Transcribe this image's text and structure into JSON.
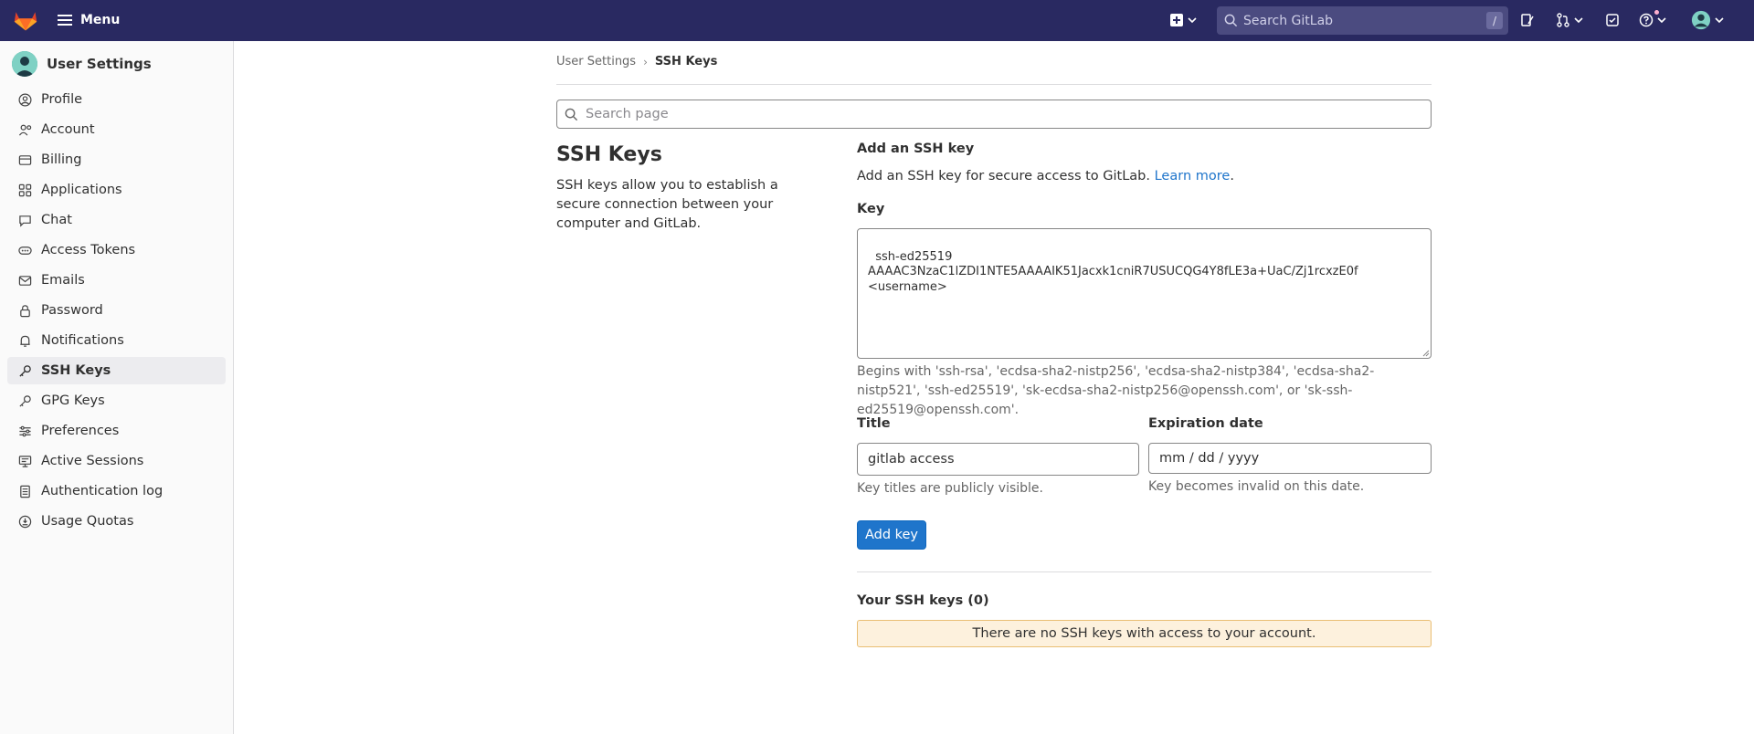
{
  "topbar": {
    "menu_label": "Menu",
    "search_placeholder": "Search GitLab",
    "search_shortcut": "/"
  },
  "sidebar": {
    "title": "User Settings",
    "items": [
      {
        "label": "Profile",
        "icon": "user-icon"
      },
      {
        "label": "Account",
        "icon": "account-icon"
      },
      {
        "label": "Billing",
        "icon": "billing-icon"
      },
      {
        "label": "Applications",
        "icon": "applications-icon"
      },
      {
        "label": "Chat",
        "icon": "chat-icon"
      },
      {
        "label": "Access Tokens",
        "icon": "token-icon"
      },
      {
        "label": "Emails",
        "icon": "mail-icon"
      },
      {
        "label": "Password",
        "icon": "lock-icon"
      },
      {
        "label": "Notifications",
        "icon": "bell-icon"
      },
      {
        "label": "SSH Keys",
        "icon": "key-icon",
        "active": true
      },
      {
        "label": "GPG Keys",
        "icon": "key-icon"
      },
      {
        "label": "Preferences",
        "icon": "preferences-icon"
      },
      {
        "label": "Active Sessions",
        "icon": "monitor-icon"
      },
      {
        "label": "Authentication log",
        "icon": "log-icon"
      },
      {
        "label": "Usage Quotas",
        "icon": "quota-icon"
      }
    ]
  },
  "breadcrumb": {
    "parent": "User Settings",
    "current": "SSH Keys"
  },
  "page_search_placeholder": "Search page",
  "section": {
    "title": "SSH Keys",
    "description": "SSH keys allow you to establish a secure connection between your computer and GitLab."
  },
  "form": {
    "heading": "Add an SSH key",
    "intro": "Add an SSH key for secure access to GitLab.",
    "learn_more": "Learn more",
    "intro_end": ".",
    "key_label": "Key",
    "key_value": "ssh-ed25519\nAAAAC3NzaC1lZDI1NTE5AAAAIK51Jacxk1cniR7USUCQG4Y8fLE3a+UaC/Zj1rcxzE0f\n<username>",
    "key_help": "Begins with 'ssh-rsa', 'ecdsa-sha2-nistp256', 'ecdsa-sha2-nistp384', 'ecdsa-sha2-nistp521', 'ssh-ed25519', 'sk-ecdsa-sha2-nistp256@openssh.com', or 'sk-ssh-ed25519@openssh.com'.",
    "title_label": "Title",
    "title_value": "gitlab access",
    "title_help": "Key titles are publicly visible.",
    "expiration_label": "Expiration date",
    "expiration_value": "mm / dd / yyyy",
    "expiration_help": "Key becomes invalid on this date.",
    "submit_label": "Add key"
  },
  "keys_list": {
    "heading": "Your SSH keys (0)",
    "empty_message": "There are no SSH keys with access to your account."
  }
}
